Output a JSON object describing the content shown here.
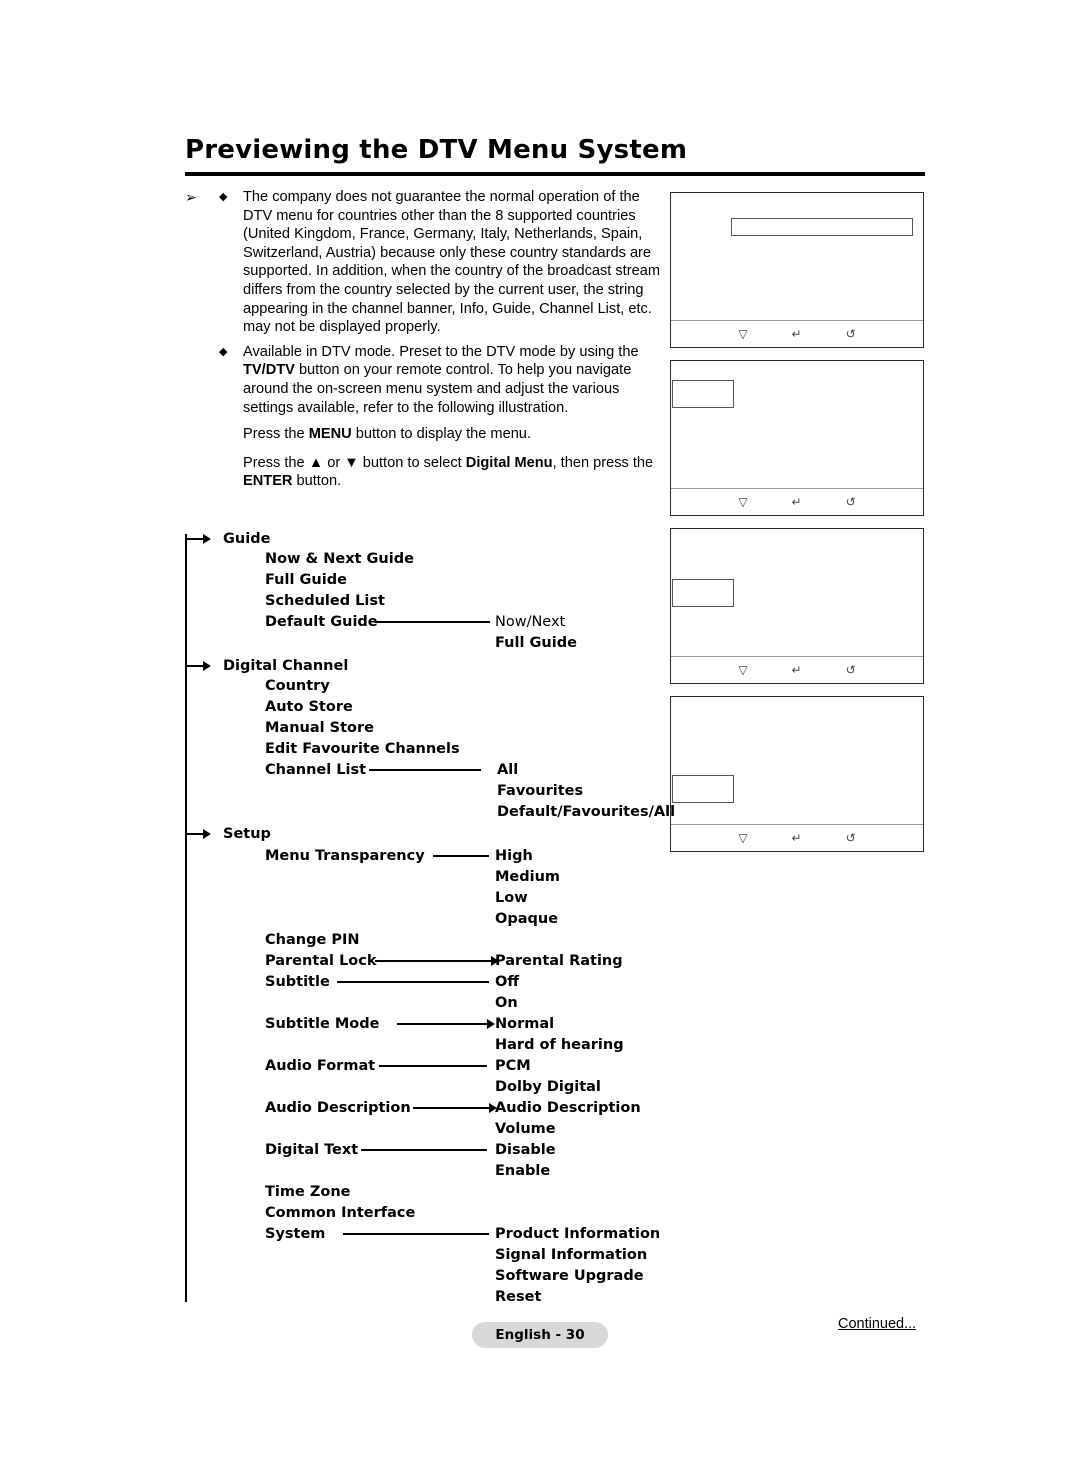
{
  "page": {
    "title": "Previewing the DTV Menu System",
    "page_badge": "English - 30",
    "continued": "Continued..."
  },
  "intro": {
    "bullet1": "The company does not guarantee the normal operation of the DTV menu for countries other than the 8 supported countries (United Kingdom, France, Germany, Italy, Netherlands, Spain, Switzerland, Austria) because only these country standards are supported. In addition, when the country of the broadcast stream differs from the country selected by the current user, the string appearing in the channel banner, Info, Guide, Channel List, etc. may not be displayed properly.",
    "bullet2_part1": "Available in DTV mode. Preset to the DTV mode by using the ",
    "bullet2_bold": "TV/DTV",
    "bullet2_part2": " button on your remote control.",
    "bullet2_line3": "To help you navigate around the on-screen menu system and adjust the various settings available, refer to the following illustration.",
    "press_menu_pre": "Press the ",
    "press_menu_bold": "MENU",
    "press_menu_post": " button to display the menu.",
    "press_updown_pre": "Press the ",
    "press_updown_up": "▲",
    "press_updown_mid": " or ",
    "press_updown_down": "▼",
    "press_updown_post": " button to select ",
    "press_updown_bold": "Digital Menu",
    "press_updown_end": ", then press the ",
    "press_updown_bold2": "ENTER",
    "press_updown_end2": " button."
  },
  "tv_icons": {
    "down": "▽",
    "enter": "↵",
    "return": "↺"
  },
  "tree": {
    "guide": {
      "label": "Guide",
      "children": [
        "Now & Next Guide",
        "Full Guide",
        "Scheduled List",
        "Default Guide"
      ],
      "default_guide_options": [
        "Now/Next",
        "Full Guide"
      ]
    },
    "digital_channel": {
      "label": "Digital Channel",
      "children": [
        "Country",
        "Auto Store",
        "Manual Store",
        "Edit Favourite Channels",
        "Channel List"
      ],
      "channel_list_options": [
        "All",
        "Favourites",
        "Default/Favourites/All"
      ]
    },
    "setup": {
      "label": "Setup",
      "children": [
        "Menu Transparency",
        "Change PIN",
        "Parental Lock",
        "Subtitle",
        "Subtitle Mode",
        "Audio Format",
        "Audio Description",
        "Digital Text",
        "Time Zone",
        "Common Interface",
        "System"
      ],
      "menu_transparency_options": [
        "High",
        "Medium",
        "Low",
        "Opaque"
      ],
      "parental_lock_options": [
        "Parental Rating"
      ],
      "subtitle_options": [
        "Off",
        "On"
      ],
      "subtitle_mode_options": [
        "Normal",
        "Hard of hearing"
      ],
      "audio_format_options": [
        "PCM",
        "Dolby Digital"
      ],
      "audio_description_options": [
        "Audio Description",
        "Volume"
      ],
      "digital_text_options": [
        "Disable",
        "Enable"
      ],
      "system_options": [
        "Product Information",
        "Signal Information",
        "Software Upgrade",
        "Reset"
      ]
    }
  }
}
